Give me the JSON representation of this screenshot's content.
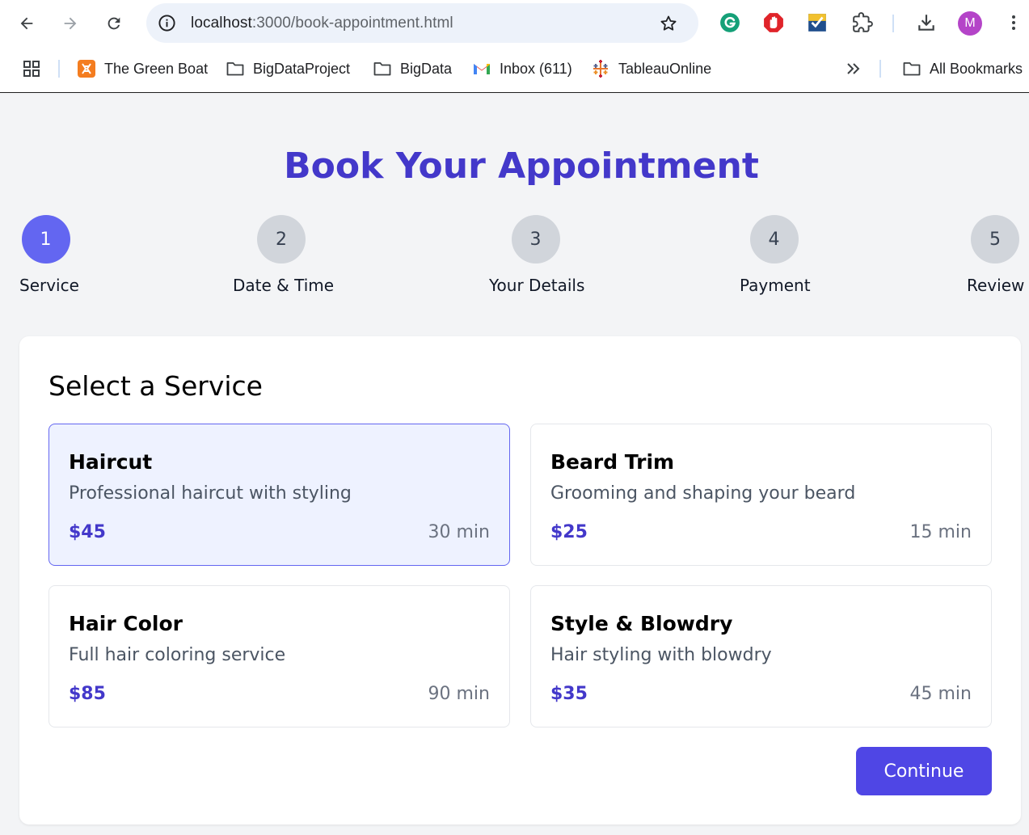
{
  "browser": {
    "url_host": "localhost",
    "url_path": ":3000/book-appointment.html",
    "avatar_letter": "M",
    "bookmarks": [
      {
        "label": "The Green Boat"
      },
      {
        "label": "BigDataProject"
      },
      {
        "label": "BigData"
      },
      {
        "label": "Inbox (611)"
      },
      {
        "label": "TableauOnline"
      },
      {
        "label": "All Bookmarks"
      }
    ]
  },
  "page": {
    "title": "Book Your Appointment",
    "steps": [
      {
        "number": "1",
        "label": "Service",
        "active": true
      },
      {
        "number": "2",
        "label": "Date & Time",
        "active": false
      },
      {
        "number": "3",
        "label": "Your Details",
        "active": false
      },
      {
        "number": "4",
        "label": "Payment",
        "active": false
      },
      {
        "number": "5",
        "label": "Review",
        "active": false
      }
    ],
    "section_title": "Select a Service",
    "services": [
      {
        "name": "Haircut",
        "description": "Professional haircut with styling",
        "price": "$45",
        "duration": "30 min",
        "selected": true
      },
      {
        "name": "Beard Trim",
        "description": "Grooming and shaping your beard",
        "price": "$25",
        "duration": "15 min",
        "selected": false
      },
      {
        "name": "Hair Color",
        "description": "Full hair coloring service",
        "price": "$85",
        "duration": "90 min",
        "selected": false
      },
      {
        "name": "Style & Blowdry",
        "description": "Hair styling with blowdry",
        "price": "$35",
        "duration": "45 min",
        "selected": false
      }
    ],
    "continue_label": "Continue"
  },
  "colors": {
    "accent": "#4338ca",
    "step_active": "#6366f1",
    "button": "#4f46e5",
    "selected_bg": "#eef2ff"
  }
}
